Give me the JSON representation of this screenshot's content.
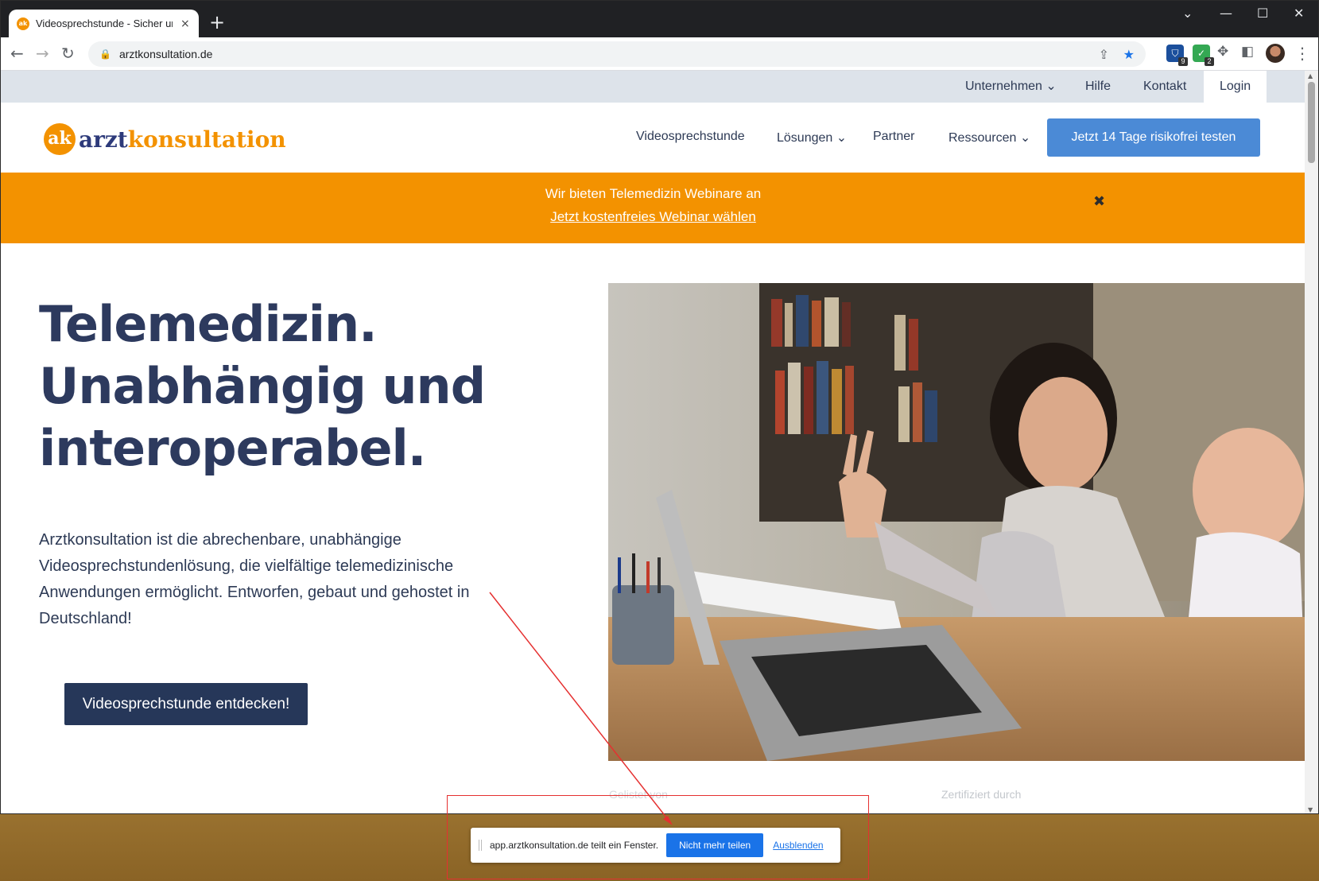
{
  "browser": {
    "tab_title": "Videosprechstunde - Sicher und",
    "tab_close": "×",
    "new_tab": "+",
    "url": "arztkonsultation.de",
    "window_controls": [
      "⌄",
      "—",
      "☐",
      "✕"
    ],
    "extensions": [
      {
        "icon": "shield-ext-icon",
        "badge": "9",
        "color": "#1b4f9c"
      },
      {
        "icon": "check-ext-icon",
        "badge": "2",
        "color": "#34a853"
      }
    ]
  },
  "site": {
    "topbar": {
      "links": [
        "Unternehmen ⌄",
        "Hilfe",
        "Kontakt"
      ],
      "login": "Login"
    },
    "logo": {
      "mark": "ak",
      "word1": "arzt",
      "word2": "konsultation"
    },
    "nav": [
      "Videosprechstunde",
      "Lösungen ⌄",
      "Partner",
      "Ressourcen ⌄"
    ],
    "cta_top": "Jetzt 14 Tage risikofrei testen",
    "banner": {
      "line1": "Wir bieten Telemedizin Webinare an",
      "line2": "Jetzt kostenfreies Webinar wählen",
      "close": "✖"
    },
    "hero": {
      "title_lines": [
        "Telemedizin.",
        "Unabhängig und",
        "interoperabel."
      ],
      "description": "Arztkonsultation ist die abrechenbare, unabhängige Videosprechstundenlösung, die vielfältige telemedizinische Anwendungen ermöglicht. Entworfen, gebaut und gehostet in Deutschland!",
      "button": "Videosprechstunde entdecken!"
    },
    "below_photo": {
      "left": "Gelistet von",
      "right": "Zertifiziert durch"
    }
  },
  "share_bar": {
    "message": "app.arztkonsultation.de teilt ein Fenster.",
    "stop_button": "Nicht mehr teilen",
    "hide_link": "Ausblenden"
  },
  "colors": {
    "accent_orange": "#f39200",
    "navy": "#263759",
    "cta_blue": "#4b8ad6",
    "annotation_red": "#e53030"
  }
}
